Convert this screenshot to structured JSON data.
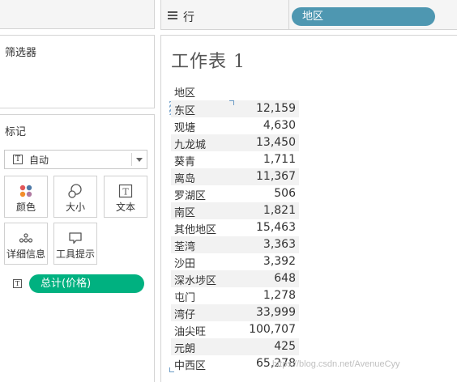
{
  "left": {
    "filters_title": "筛选器",
    "marks_title": "标记",
    "mark_type": "自动",
    "mark_buttons": [
      {
        "label": "颜色",
        "icon": "color-dots-icon"
      },
      {
        "label": "大小",
        "icon": "size-circles-icon"
      },
      {
        "label": "文本",
        "icon": "text-icon"
      },
      {
        "label": "详细信息",
        "icon": "detail-dots-icon"
      },
      {
        "label": "工具提示",
        "icon": "tooltip-icon"
      }
    ],
    "measure_pill": "总计(价格)"
  },
  "shelf": {
    "row_label": "行",
    "row_pill": "地区"
  },
  "sheet": {
    "title": "工作表 1",
    "column_header": "地区",
    "rows": [
      {
        "name": "东区",
        "value": "12,159"
      },
      {
        "name": "观塘",
        "value": "4,630"
      },
      {
        "name": "九龙城",
        "value": "13,450"
      },
      {
        "name": "葵青",
        "value": "1,711"
      },
      {
        "name": "离岛",
        "value": "11,367"
      },
      {
        "name": "罗湖区",
        "value": "506"
      },
      {
        "name": "南区",
        "value": "1,821"
      },
      {
        "name": "其他地区",
        "value": "15,463"
      },
      {
        "name": "荃湾",
        "value": "3,363"
      },
      {
        "name": "沙田",
        "value": "3,392"
      },
      {
        "name": "深水埗区",
        "value": "648"
      },
      {
        "name": "屯门",
        "value": "1,278"
      },
      {
        "name": "湾仔",
        "value": "33,999"
      },
      {
        "name": "油尖旺",
        "value": "100,707"
      },
      {
        "name": "元朗",
        "value": "425"
      },
      {
        "name": "中西区",
        "value": "65,278"
      }
    ]
  },
  "watermark": "https://blog.csdn.net/AvenueCyy",
  "colors": {
    "row_pill": "#4e97b1",
    "measure_pill": "#00b180",
    "band": "#f2f2f2"
  }
}
